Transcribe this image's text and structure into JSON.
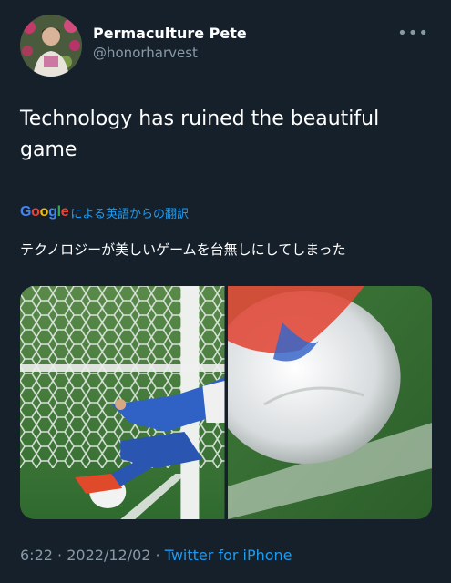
{
  "author": {
    "display_name": "Permaculture Pete",
    "handle": "@honorharvest"
  },
  "more_icon": "ellipsis-icon",
  "tweet": {
    "text": "Technology has ruined the beautiful game"
  },
  "translation": {
    "logo_text": "Google",
    "label": "による英語からの翻訳",
    "text": "テクノロジーが美しいゲームを台無しにしてしまった"
  },
  "media": {
    "photo_count": 2
  },
  "meta": {
    "time": "6:22",
    "date": "2022/12/02",
    "separator": "·",
    "source": "Twitter for iPhone"
  },
  "colors": {
    "background": "#15202b",
    "secondary_text": "#8899a6",
    "link": "#1d9bf0"
  }
}
